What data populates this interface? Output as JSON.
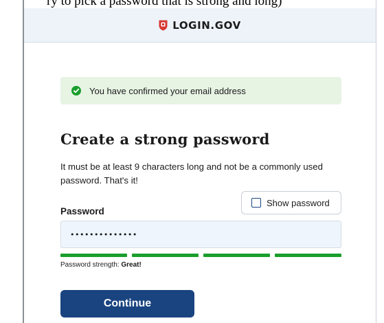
{
  "caption": "ry to pick a password that is strong and long)",
  "header": {
    "brand": "LOGIN.GOV"
  },
  "alert": {
    "message": "You have confirmed your email address",
    "color": "#e7f4e4"
  },
  "form": {
    "title": "Create a strong password",
    "description": "It must be at least 9 characters long and not be a commonly used password. That's it!",
    "show_password_label": "Show password",
    "show_password_checked": false,
    "password_label": "Password",
    "password_value": "••••••••••••••",
    "strength_label": "Password strength:",
    "strength_value": "Great!",
    "strength_level": 4,
    "strength_segments": 4,
    "continue_label": "Continue"
  },
  "colors": {
    "primary": "#1a4480",
    "success": "#1a9e2c",
    "logo_red": "#d83933"
  }
}
